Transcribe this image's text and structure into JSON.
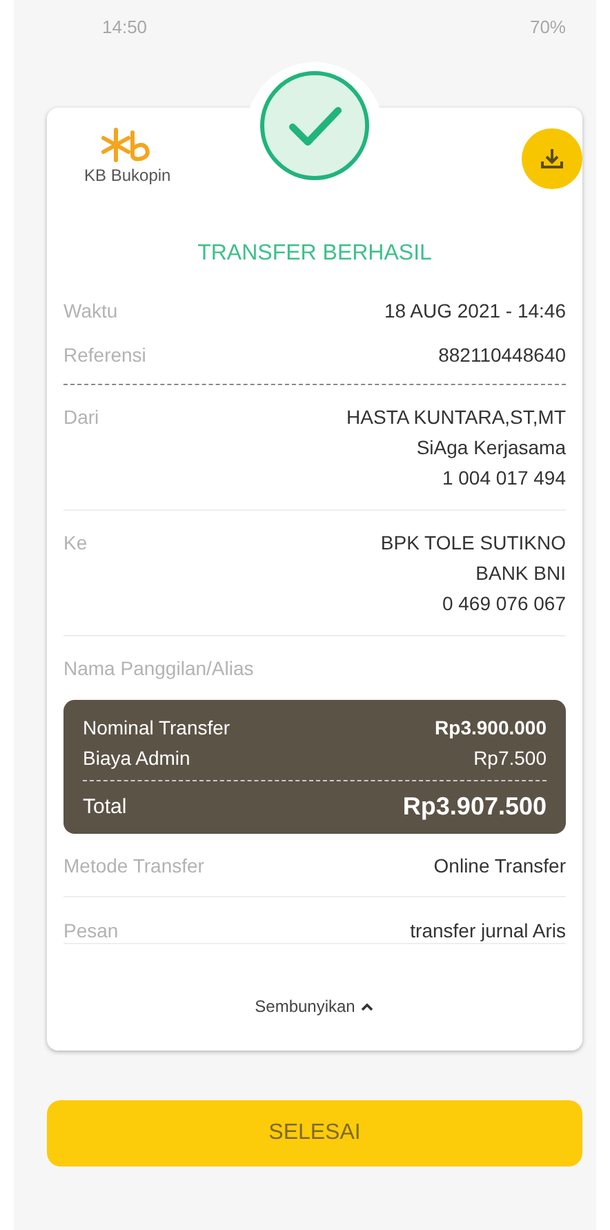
{
  "status_bar": {
    "time": "14:50",
    "battery": "70%"
  },
  "receipt": {
    "bank_name": "KB Bukopin",
    "status": "TRANSFER BERHASIL",
    "info": [
      {
        "label": "Waktu",
        "value": "18 AUG 2021 - 14:46"
      },
      {
        "label": "Referensi",
        "value": "882110448640"
      }
    ],
    "parties": [
      {
        "label": "Dari",
        "lines": [
          "HASTA KUNTARA,ST,MT",
          "SiAga Kerjasama",
          "1 004 017 494"
        ]
      },
      {
        "label": "Ke",
        "lines": [
          "BPK TOLE SUTIKNO",
          "BANK BNI",
          "0 469 076 067"
        ]
      },
      {
        "label": "Nama Panggilan/Alias"
      }
    ],
    "summary": {
      "items": [
        {
          "label": "Nominal Transfer",
          "value": "Rp3.900.000"
        },
        {
          "label": "Biaya Admin",
          "value": "Rp7.500"
        }
      ],
      "total": {
        "label": "Total",
        "value": "Rp3.907.500"
      }
    },
    "extra": [
      {
        "label": "Metode Transfer",
        "value": "Online Transfer"
      },
      {
        "label": "Pesan",
        "value": "transfer jurnal Aris"
      }
    ],
    "toggle": {
      "label": "Sembunyikan",
      "expanded": true
    }
  },
  "done_button": {
    "label": "SELESAI"
  }
}
